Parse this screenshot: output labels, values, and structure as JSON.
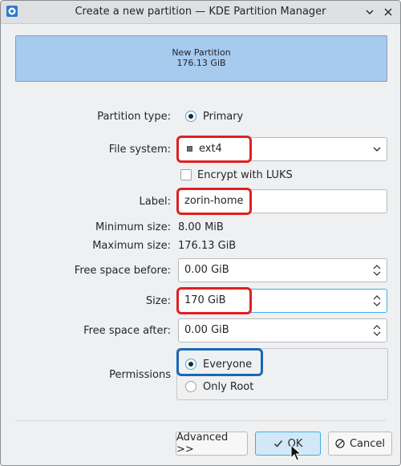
{
  "window": {
    "title": "Create a new partition — KDE Partition Manager"
  },
  "partition_graphic": {
    "name": "New Partition",
    "size": "176.13 GiB",
    "color": "#a7caef"
  },
  "form": {
    "partition_type": {
      "label": "Partition type:",
      "option": "Primary",
      "selected": true
    },
    "file_system": {
      "label": "File system:",
      "value": "ext4"
    },
    "encrypt": {
      "label": "Encrypt with LUKS",
      "checked": false
    },
    "partition_label": {
      "label": "Label:",
      "value": "zorin-home"
    },
    "minimum_size": {
      "label": "Minimum size:",
      "value": "8.00 MiB"
    },
    "maximum_size": {
      "label": "Maximum size:",
      "value": "176.13 GiB"
    },
    "free_space_before": {
      "label": "Free space before:",
      "value": "0.00 GiB"
    },
    "size": {
      "label": "Size:",
      "value": "170 GiB"
    },
    "free_space_after": {
      "label": "Free space after:",
      "value": "0.00 GiB"
    },
    "permissions": {
      "label": "Permissions",
      "options": [
        {
          "label": "Everyone",
          "selected": true
        },
        {
          "label": "Only Root",
          "selected": false
        }
      ]
    }
  },
  "buttons": {
    "advanced": "Advanced >>",
    "ok": "OK",
    "cancel": "Cancel"
  },
  "highlights": {
    "red": "#e02020",
    "blue": "#1a68b5"
  },
  "icons": {
    "app": "partition-manager-icon",
    "minimize": "chevron-down-icon",
    "close": "close-icon"
  }
}
